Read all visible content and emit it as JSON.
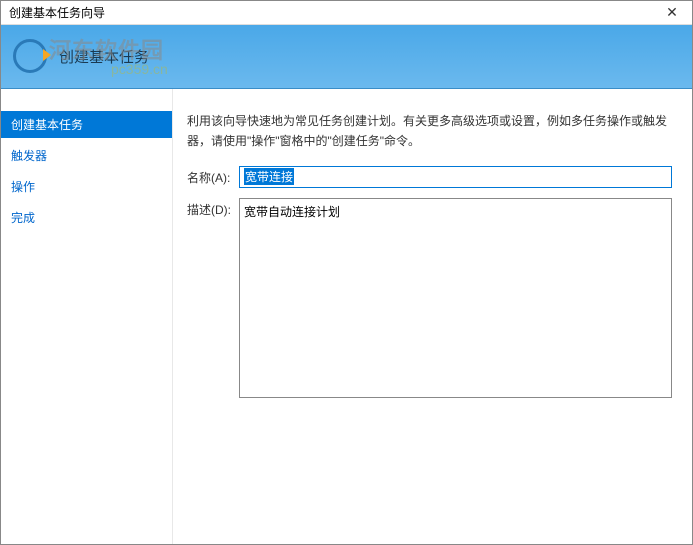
{
  "window": {
    "title": "创建基本任务向导",
    "close_label": "✕"
  },
  "header": {
    "title": "创建基本任务"
  },
  "watermark": {
    "main": "河东软件园",
    "sub": "pc359.cn"
  },
  "sidebar": {
    "items": [
      {
        "label": "创建基本任务",
        "active": true
      },
      {
        "label": "触发器",
        "active": false
      },
      {
        "label": "操作",
        "active": false
      },
      {
        "label": "完成",
        "active": false
      }
    ]
  },
  "main": {
    "intro": "利用该向导快速地为常见任务创建计划。有关更多高级选项或设置，例如多任务操作或触发器，请使用\"操作\"窗格中的\"创建任务\"命令。",
    "name_label": "名称(A):",
    "name_value": "宽带连接",
    "desc_label": "描述(D):",
    "desc_value": "宽带自动连接计划"
  }
}
